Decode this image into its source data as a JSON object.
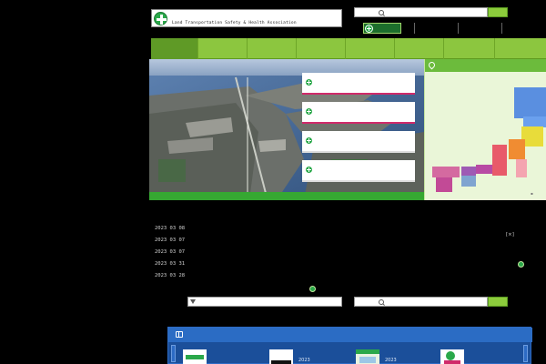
{
  "header": {
    "title": "",
    "subtitle": "Land Transportation Safety & Health Association",
    "search_top_placeholder": "",
    "search_top_button": "",
    "pill_label": ""
  },
  "nav": {
    "items": [
      {
        "label": "",
        "sub": ""
      },
      {
        "label": "",
        "sub": ""
      },
      {
        "label": "",
        "sub": ""
      },
      {
        "label": "",
        "sub": ""
      },
      {
        "label": "",
        "sub": ""
      },
      {
        "label": "",
        "sub": ""
      },
      {
        "label": "",
        "sub": ""
      },
      {
        "label": "",
        "sub": ""
      }
    ]
  },
  "hero": {
    "line1": "",
    "line2": "",
    "caption": "",
    "cards": [
      "",
      "",
      "",
      ""
    ]
  },
  "map_panel": {
    "heading": ""
  },
  "news": {
    "heading": "",
    "items": [
      {
        "date": "2023 03 08",
        "text": ""
      },
      {
        "date": "2023 03 07",
        "text": ""
      },
      {
        "date": "2023 03 07",
        "text": ""
      },
      {
        "date": "2023 03 31",
        "text": ""
      },
      {
        "date": "2023 03 28",
        "text": ""
      }
    ],
    "more": ""
  },
  "side": {
    "heading": "",
    "close": "[×]",
    "more": ""
  },
  "bottom_search": {
    "placeholder": "",
    "button": ""
  },
  "filter": {
    "placeholder": ""
  },
  "banners": {
    "heading": "",
    "items": [
      {
        "label": "",
        "sub": ""
      },
      {
        "label": "",
        "sub": "2023"
      },
      {
        "label": "",
        "sub": "2023"
      },
      {
        "label": "",
        "sub": ""
      }
    ]
  }
}
